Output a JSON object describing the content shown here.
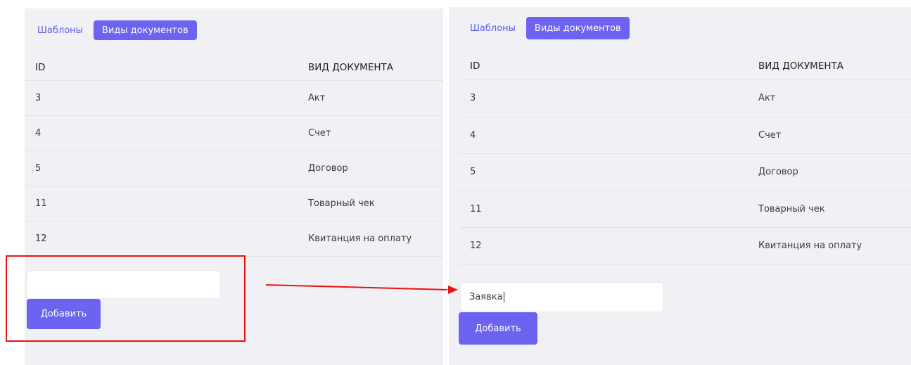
{
  "before": {
    "tabs": {
      "templates": "Шаблоны",
      "doc_types": "Виды документов"
    },
    "table": {
      "headers": {
        "id": "ID",
        "kind": "ВИД ДОКУМЕНТА"
      },
      "rows": [
        {
          "id": "3",
          "kind": "Акт"
        },
        {
          "id": "4",
          "kind": "Счет"
        },
        {
          "id": "5",
          "kind": "Договор"
        },
        {
          "id": "11",
          "kind": "Товарный чек"
        },
        {
          "id": "12",
          "kind": "Квитанция на оплату"
        }
      ]
    },
    "input": {
      "value": ""
    },
    "add_label": "Добавить"
  },
  "after": {
    "tabs": {
      "templates": "Шаблоны",
      "doc_types": "Виды документов"
    },
    "table": {
      "headers": {
        "id": "ID",
        "kind": "ВИД ДОКУМЕНТА"
      },
      "rows": [
        {
          "id": "3",
          "kind": "Акт"
        },
        {
          "id": "4",
          "kind": "Счет"
        },
        {
          "id": "5",
          "kind": "Договор"
        },
        {
          "id": "11",
          "kind": "Товарный чек"
        },
        {
          "id": "12",
          "kind": "Квитанция на оплату"
        }
      ]
    },
    "input": {
      "value": "Заявка"
    },
    "add_label": "Добавить"
  },
  "colors": {
    "accent": "#6c63f0",
    "link": "#5b5fe6",
    "panel_bg": "#f1f0f5",
    "annotation": "#ee1111"
  }
}
